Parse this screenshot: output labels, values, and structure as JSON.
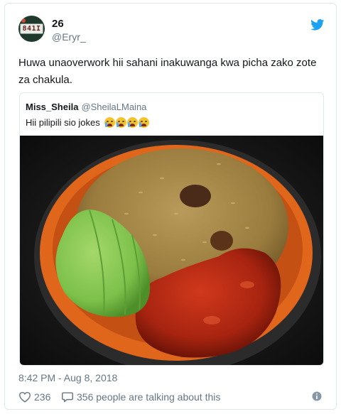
{
  "tweet": {
    "display_name": "26",
    "handle": "@Eryr_",
    "avatar_plate_text": "841I",
    "text": "Huwa unaoverwork hii sahani inakuwanga kwa picha zako zote za chakula.",
    "timestamp": "8:42 PM - Aug 8, 2018",
    "likes": "236",
    "replies_text": "356 people are talking about this"
  },
  "quoted_tweet": {
    "name": "Miss_Sheila",
    "handle": "@SheilaLMaina",
    "text": "Hii pilipili sio jokes",
    "emoji_count": 4,
    "image_description_icon": "photo"
  },
  "colors": {
    "twitter_blue": "#1da1f2",
    "secondary_text": "#657786",
    "border": "#e1e8ed"
  },
  "icons": {
    "brand": "twitter-bird-icon",
    "like": "heart-icon",
    "reply": "reply-bubble-icon",
    "info": "info-icon"
  }
}
